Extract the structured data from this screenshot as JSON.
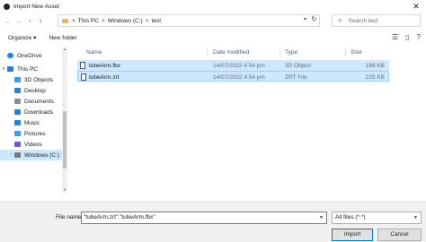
{
  "window": {
    "title": "Import New Asset",
    "close_glyph": "✕"
  },
  "address": {
    "crumbs": [
      "This PC",
      "Windows (C:)",
      "test"
    ],
    "separator": ">",
    "search_placeholder": "Search test"
  },
  "toolbar": {
    "organize_label": "Organize ▾",
    "new_folder_label": "New folder"
  },
  "nav": {
    "items": [
      {
        "label": "OneDrive",
        "icon": "cloud-icon",
        "color": "#1e88e5"
      },
      {
        "label": "This PC",
        "icon": "computer-icon",
        "color": "#2f7fd1"
      },
      {
        "label": "3D Objects",
        "icon": "cube-icon",
        "color": "#3d9be9"
      },
      {
        "label": "Desktop",
        "icon": "desktop-icon",
        "color": "#2f7fd1"
      },
      {
        "label": "Documents",
        "icon": "documents-icon",
        "color": "#8c8c8c"
      },
      {
        "label": "Downloads",
        "icon": "download-icon",
        "color": "#2f7fd1"
      },
      {
        "label": "Music",
        "icon": "music-icon",
        "color": "#2f7fd1"
      },
      {
        "label": "Pictures",
        "icon": "pictures-icon",
        "color": "#3d9be9"
      },
      {
        "label": "Videos",
        "icon": "videos-icon",
        "color": "#6b5bd6"
      },
      {
        "label": "Windows (C:)",
        "icon": "drive-icon",
        "color": "#7a7a7a"
      }
    ]
  },
  "columns": {
    "name": "Name",
    "date": "Date modified",
    "type": "Type",
    "size": "Size"
  },
  "files": [
    {
      "name": "tubeArm.fbx",
      "date": "14/07/2022 4:54 pm",
      "type": "3D Object",
      "size": "188 KB"
    },
    {
      "name": "tubeArm.zrt",
      "date": "14/07/2022 4:54 pm",
      "type": "ZRT File",
      "size": "225 KB"
    }
  ],
  "footer": {
    "file_name_label": "File name:",
    "file_name_value": "\"tubeArm.zrt\" \"tubeArm.fbx\"",
    "file_type_value": "All files (*.*)",
    "import_label": "Import",
    "cancel_label": "Cancel"
  },
  "colors": {
    "selection": "#cce8ff",
    "accent": "#0078d7"
  }
}
